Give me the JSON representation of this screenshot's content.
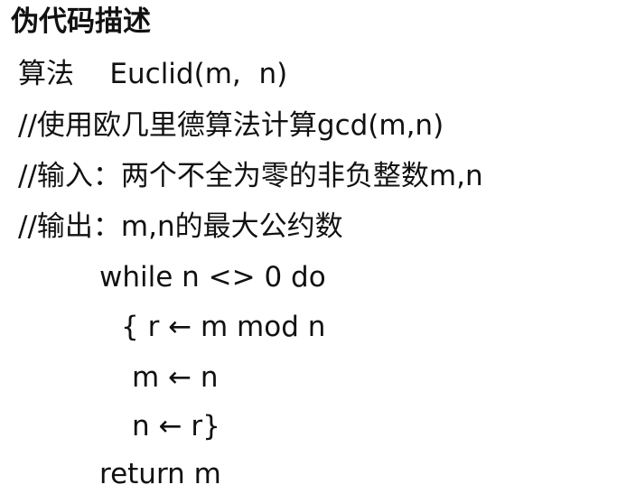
{
  "title": "伪代码描述",
  "lines": [
    "算法    Euclid(m,  n)",
    "//使用欧几里德算法计算gcd(m,n)",
    "//输入：两个不全为零的非负整数m,n",
    "//输出：m,n的最大公约数",
    "while n <> 0 do",
    "{ r ← m mod n",
    "m ← n",
    "n ← r}",
    "return m"
  ]
}
